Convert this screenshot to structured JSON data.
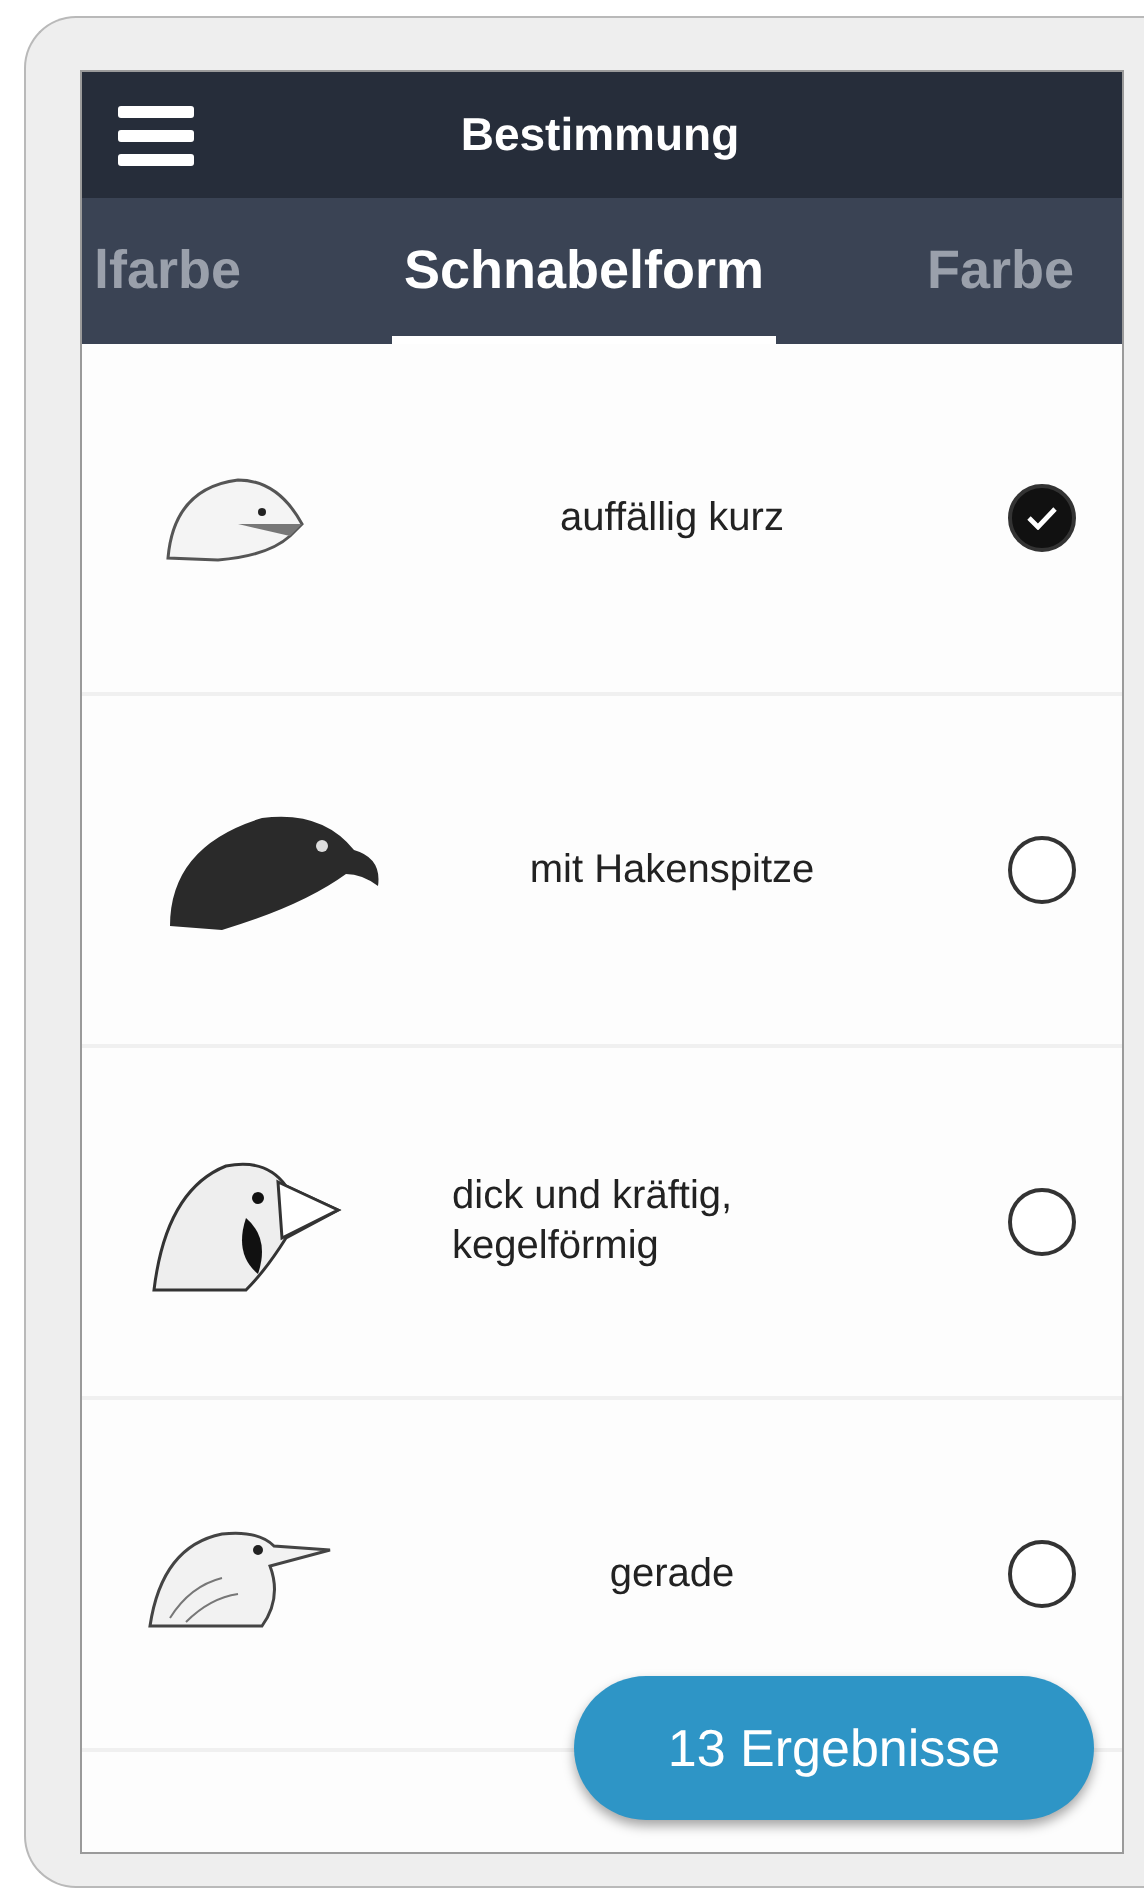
{
  "header": {
    "title": "Bestimmung"
  },
  "tabs": [
    {
      "label": "lfarbe",
      "selected": false
    },
    {
      "label": "Schnabelform",
      "selected": true
    },
    {
      "label": "Farbe",
      "selected": false
    }
  ],
  "options": [
    {
      "kind": "short",
      "label": "auffällig kurz",
      "checked": true
    },
    {
      "kind": "hooked",
      "label": "mit Hakenspitze",
      "checked": false
    },
    {
      "kind": "conical",
      "label": "dick und kräftig, kegelförmig",
      "checked": false
    },
    {
      "kind": "straight",
      "label": "gerade",
      "checked": false
    }
  ],
  "results_button": {
    "label": "13 Ergebnisse"
  }
}
